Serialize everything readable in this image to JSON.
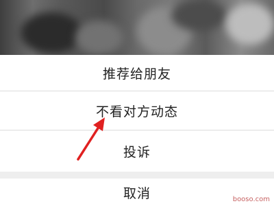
{
  "action_sheet": {
    "options": [
      {
        "label": "推荐给朋友"
      },
      {
        "label": "不看对方动态"
      },
      {
        "label": "投诉"
      }
    ],
    "cancel_label": "取消"
  },
  "annotation": {
    "arrow_color": "#e02020",
    "points_to": "不看对方动态"
  },
  "watermark": {
    "text": "booso.com"
  },
  "colors": {
    "sheet_background": "#ffffff",
    "separator": "#dcdcdc",
    "text": "#222222"
  }
}
